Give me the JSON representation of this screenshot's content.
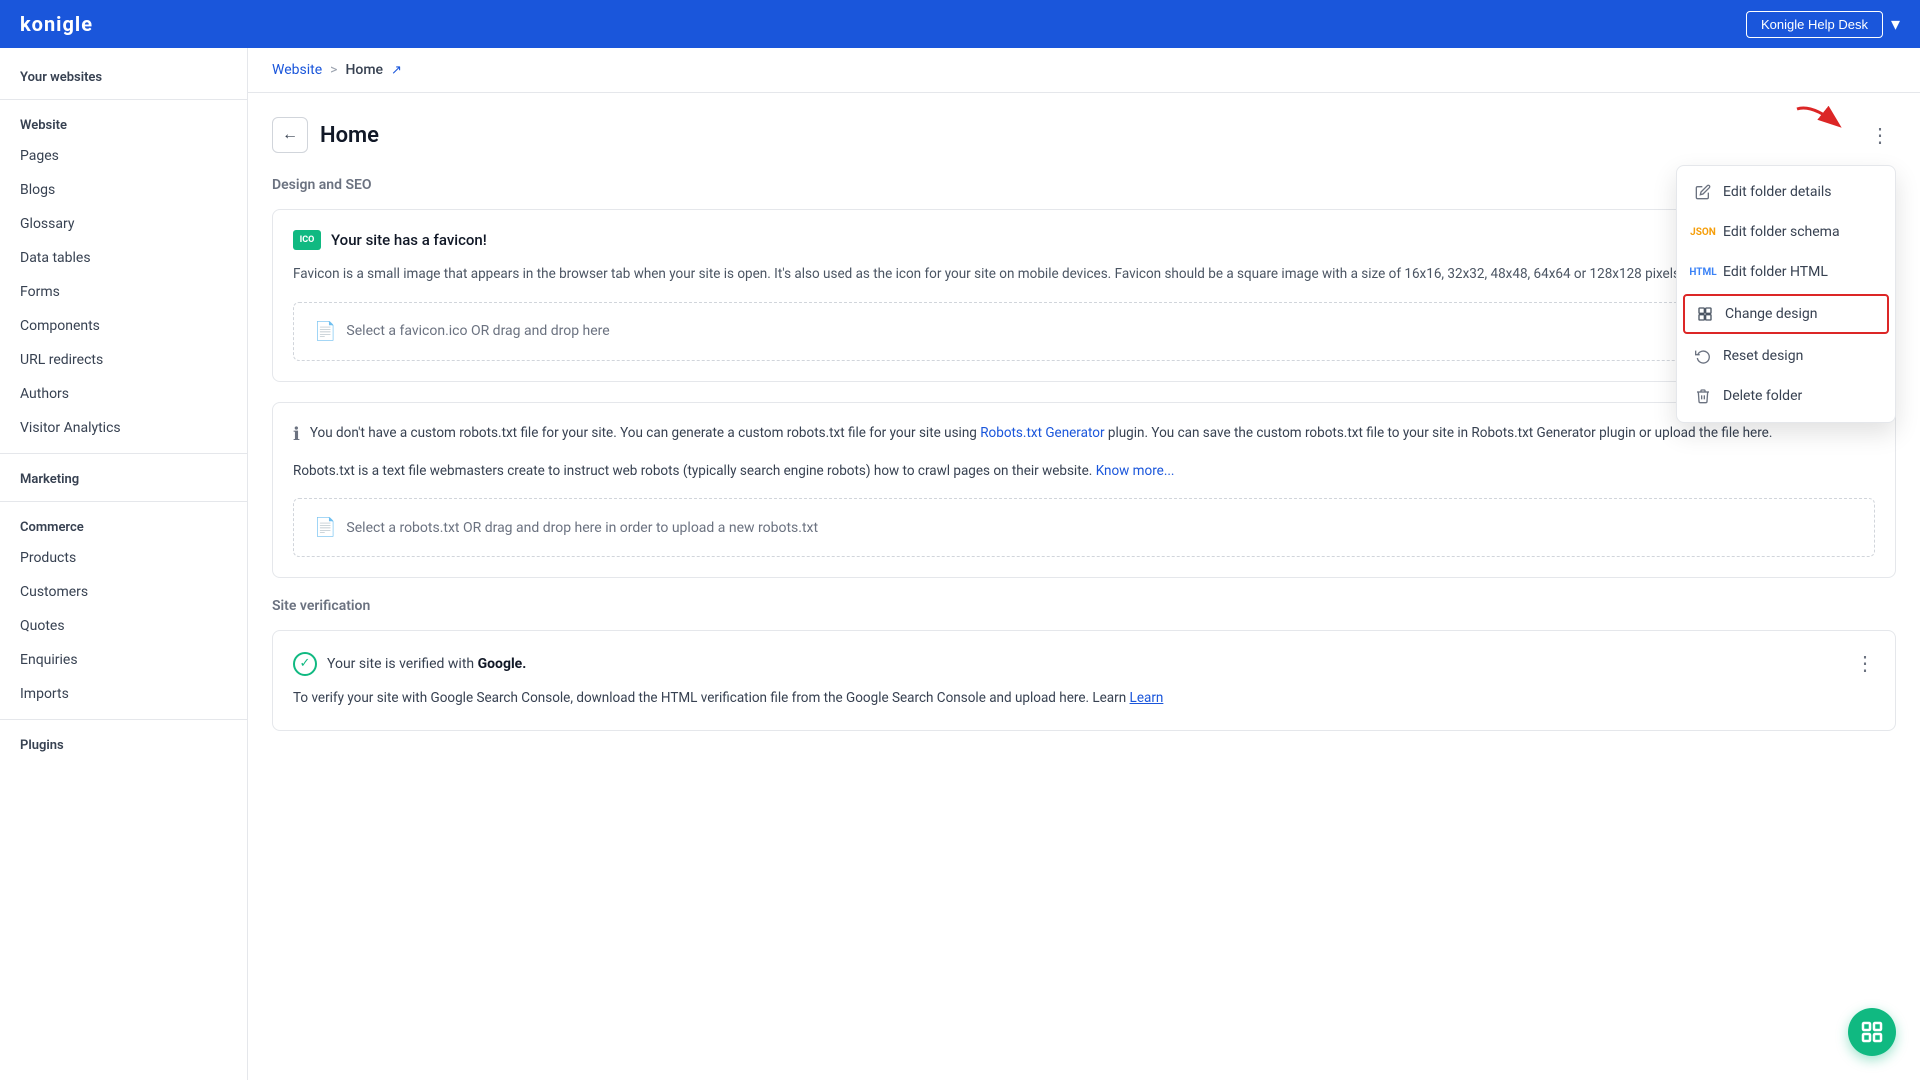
{
  "topnav": {
    "logo": "konigle",
    "help_desk_label": "Konigle Help Desk",
    "chevron": "▾"
  },
  "sidebar": {
    "your_websites_label": "Your websites",
    "website_section": "Website",
    "items": [
      {
        "id": "pages",
        "label": "Pages"
      },
      {
        "id": "blogs",
        "label": "Blogs"
      },
      {
        "id": "glossary",
        "label": "Glossary"
      },
      {
        "id": "data-tables",
        "label": "Data tables"
      },
      {
        "id": "forms",
        "label": "Forms"
      },
      {
        "id": "components",
        "label": "Components"
      },
      {
        "id": "url-redirects",
        "label": "URL redirects"
      },
      {
        "id": "authors",
        "label": "Authors"
      },
      {
        "id": "visitor-analytics",
        "label": "Visitor Analytics"
      }
    ],
    "marketing_section": "Marketing",
    "commerce_section": "Commerce",
    "commerce_items": [
      {
        "id": "products",
        "label": "Products"
      },
      {
        "id": "customers",
        "label": "Customers"
      },
      {
        "id": "quotes",
        "label": "Quotes"
      },
      {
        "id": "enquiries",
        "label": "Enquiries"
      },
      {
        "id": "imports",
        "label": "Imports"
      }
    ],
    "plugins_section": "Plugins"
  },
  "breadcrumb": {
    "website": "Website",
    "separator": ">",
    "home": "Home",
    "external_icon": "↗"
  },
  "page": {
    "back_icon": "←",
    "title": "Home",
    "more_icon": "⋮"
  },
  "dropdown_menu": {
    "items": [
      {
        "id": "edit-folder-details",
        "label": "Edit folder details",
        "icon_type": "pencil"
      },
      {
        "id": "edit-folder-schema",
        "label": "Edit folder schema",
        "icon_type": "json"
      },
      {
        "id": "edit-folder-html",
        "label": "Edit folder HTML",
        "icon_type": "html"
      },
      {
        "id": "change-design",
        "label": "Change design",
        "icon_type": "design",
        "highlighted": true
      },
      {
        "id": "reset-design",
        "label": "Reset design",
        "icon_type": "reset"
      },
      {
        "id": "delete-folder",
        "label": "Delete folder",
        "icon_type": "trash"
      }
    ]
  },
  "design_seo": {
    "section_title": "Design and SEO",
    "favicon_icon_label": "ICO",
    "favicon_status": "Your site has a favicon!",
    "favicon_desc": "Favicon is a small image that appears in the browser tab when your site is open. It's also used as the icon for your site on mobile devices. Favicon should be a square image with a size of 16x16, 32x32, 48x48, 64x64 or 128x128 pixels.",
    "favicon_upload_placeholder": "Select a favicon.ico OR drag and drop here",
    "robots_info": "You don't have a custom robots.txt file for your site. You can generate a custom robots.txt file for your site using ",
    "robots_link": "Robots.txt Generator",
    "robots_info2": " plugin. You can save the custom robots.txt file to your site in Robots.txt Generator plugin or upload the file here.",
    "robots_desc": "Robots.txt is a text file webmasters create to instruct web robots (typically search engine robots) how to crawl pages on their website. ",
    "robots_know_more": "Know more...",
    "robots_upload_placeholder": "Select a robots.txt OR drag and drop here in order to upload a new robots.txt"
  },
  "site_verification": {
    "section_title": "Site verification",
    "verified_text_pre": "Your site is verified with ",
    "verified_bold": "Google.",
    "desc_pre": "To verify your site with Google Search Console, download the HTML verification file from the Google Search Console and upload here. Learn",
    "learn_more": "Learn"
  }
}
